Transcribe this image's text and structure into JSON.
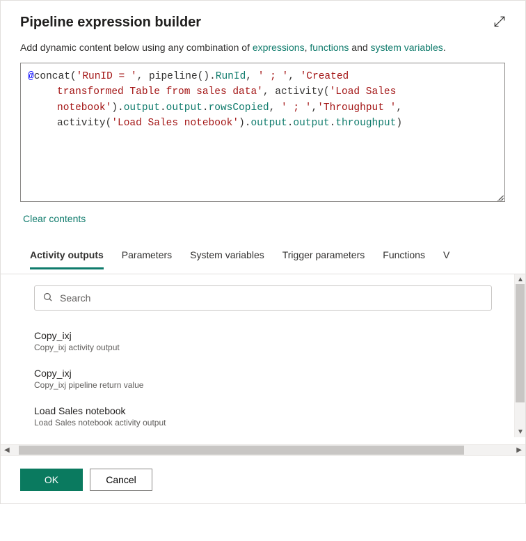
{
  "header": {
    "title": "Pipeline expression builder"
  },
  "description": {
    "prefix": "Add dynamic content below using any combination of ",
    "link_expressions": "expressions",
    "sep1": ", ",
    "link_functions": "functions",
    "sep2": " and ",
    "link_sysvars": "system variables",
    "suffix": "."
  },
  "code": {
    "l1_at": "@",
    "l1_fn1": "concat(",
    "l1_str1": "'RunID = '",
    "l1_c1": ", ",
    "l1_fn2": "pipeline()",
    "l1_dot1": ".",
    "l1_prop1": "RunId",
    "l1_c2": ", ",
    "l1_str2": "' ; '",
    "l1_c3": ", ",
    "l1_str3": "'Created",
    "l2_str1": "transformed Table from sales data'",
    "l2_c1": ", ",
    "l2_fn1": "activity(",
    "l2_str2": "'Load Sales",
    "l3_str1": "notebook'",
    "l3_fn1": ")",
    "l3_dot1": ".",
    "l3_prop1": "output",
    "l3_dot2": ".",
    "l3_prop2": "output",
    "l3_dot3": ".",
    "l3_prop3": "rowsCopied",
    "l3_c1": ", ",
    "l3_str2": "' ; '",
    "l3_c2": ",",
    "l3_str3": "'Throughput '",
    "l3_c3": ",",
    "l4_fn1": "activity(",
    "l4_str1": "'Load Sales notebook'",
    "l4_fn2": ")",
    "l4_dot1": ".",
    "l4_prop1": "output",
    "l4_dot2": ".",
    "l4_prop2": "output",
    "l4_dot3": ".",
    "l4_prop3": "throughput",
    "l4_close": ")"
  },
  "clear_label": "Clear contents",
  "tabs": {
    "activity_outputs": "Activity outputs",
    "parameters": "Parameters",
    "system_variables": "System variables",
    "trigger_parameters": "Trigger parameters",
    "functions": "Functions",
    "variables_partial": "V"
  },
  "search": {
    "placeholder": "Search"
  },
  "outputs": [
    {
      "title": "Copy_ixj",
      "desc": "Copy_ixj activity output"
    },
    {
      "title": "Copy_ixj",
      "desc": "Copy_ixj pipeline return value"
    },
    {
      "title": "Load Sales notebook",
      "desc": "Load Sales notebook activity output"
    }
  ],
  "footer": {
    "ok": "OK",
    "cancel": "Cancel"
  }
}
